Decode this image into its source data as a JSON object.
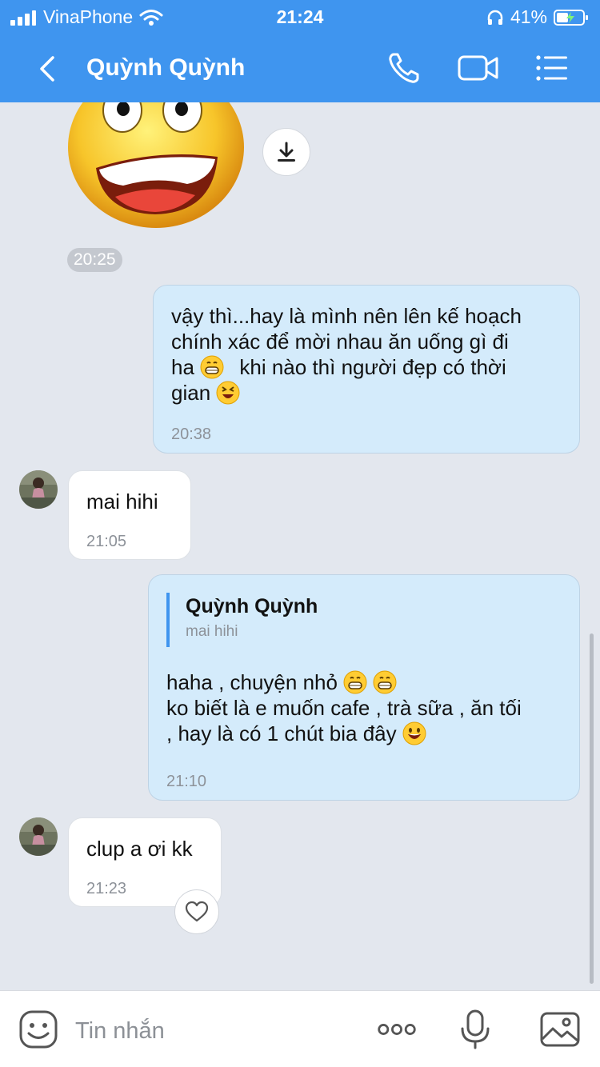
{
  "status_bar": {
    "carrier": "VinaPhone",
    "time": "21:24",
    "battery": "41%"
  },
  "header": {
    "title": "Quỳnh Quỳnh",
    "icons": [
      "back-arrow-icon",
      "phone-icon",
      "video-call-icon",
      "menu-icon"
    ]
  },
  "messages": {
    "sticker_time": "20:25",
    "m1": {
      "line1": "vậy thì...hay là mình nên lên kế hoạch",
      "line2": "chính xác để mời nhau ăn uống gì đi",
      "line3a": "ha",
      "line3b": "khi nào thì người đẹp có thời",
      "line4": "gian",
      "time": "20:38"
    },
    "m2": {
      "text": "mai hihi",
      "time": "21:05"
    },
    "m3": {
      "quote_name": "Quỳnh Quỳnh",
      "quote_text": "mai hihi",
      "line1": "haha , chuyện nhỏ",
      "line2": "ko biết là e muốn cafe , trà sữa , ăn tối",
      "line3": ", hay là có 1 chút bia đây",
      "time": "21:10"
    },
    "m4": {
      "text": "clup a ơi kk",
      "time": "21:23"
    }
  },
  "composer": {
    "placeholder": "Tin nhắn",
    "icons": [
      "emoji-icon",
      "more-icon",
      "microphone-icon",
      "image-icon"
    ]
  },
  "colors": {
    "header": "#3f95ef",
    "background": "#e3e7ee",
    "outgoing_bubble": "#d4ebfb",
    "incoming_bubble": "#ffffff"
  }
}
